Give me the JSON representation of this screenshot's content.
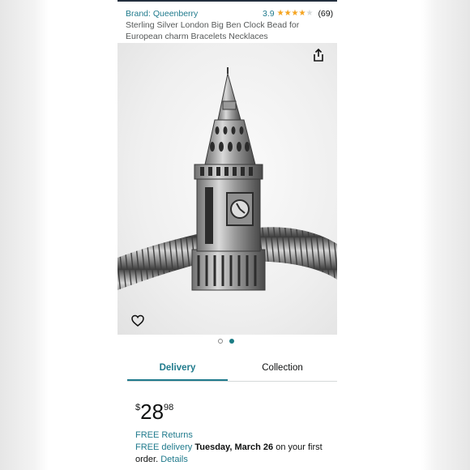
{
  "header": {
    "brand_label": "Brand: Queenberry",
    "rating_value": "3.9",
    "rating_fraction": 0.78,
    "stars_glyphs": "★★★★★",
    "review_count": "(69)",
    "product_title": "Sterling Silver London Big Ben Clock Bead for European charm Bracelets Necklaces"
  },
  "gallery": {
    "current_image": 2,
    "image_count": 2
  },
  "tabs": [
    {
      "label": "Delivery",
      "selected": true
    },
    {
      "label": "Collection",
      "selected": false
    }
  ],
  "price": {
    "symbol": "$",
    "whole": "28",
    "fraction": "98"
  },
  "delivery": {
    "returns": "FREE Returns",
    "free_delivery": "FREE delivery",
    "date": "Tuesday, March 26",
    "suffix": "on your first order.",
    "details": "Details"
  },
  "colors": {
    "link": "#1f7a8c",
    "star": "#f7a41d",
    "active_dot": "#1b7c84"
  },
  "icons": [
    "share-icon",
    "heart-icon"
  ]
}
